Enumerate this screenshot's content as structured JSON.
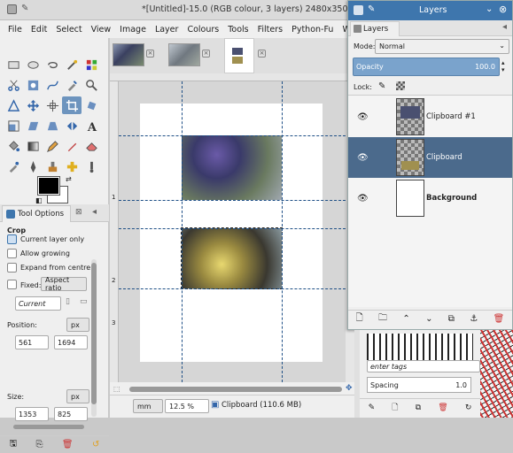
{
  "window": {
    "title": "*[Untitled]-15.0 (RGB colour, 3 layers) 2480x3508 – GIMP"
  },
  "menu": [
    "File",
    "Edit",
    "Select",
    "View",
    "Image",
    "Layer",
    "Colours",
    "Tools",
    "Filters",
    "Python-Fu",
    "Windows",
    "H"
  ],
  "tool_options": {
    "tab": "Tool Options",
    "section": "Crop",
    "current_layer_only": "Current layer only",
    "allow_growing": "Allow growing",
    "expand_from_centre": "Expand from centre",
    "fixed_label": "Fixed:",
    "fixed_value": "Aspect ratio",
    "current": "Current",
    "position_label": "Position:",
    "position_unit": "px",
    "pos_x": "561",
    "pos_y": "1694",
    "size_label": "Size:",
    "size_unit": "px",
    "size_w": "1353",
    "size_h": "825"
  },
  "statusbar": {
    "unit": "mm",
    "zoom": "12.5 %",
    "message": "Clipboard (110.6 MB)"
  },
  "ruler": {
    "v_labels": [
      "1",
      "2",
      "3"
    ],
    "h_labels": []
  },
  "layers": {
    "title": "Layers",
    "tab": "Layers",
    "mode_label": "Mode:",
    "mode_value": "Normal",
    "opacity_label": "Opacity",
    "opacity_value": "100.0",
    "lock_label": "Lock:",
    "items": [
      {
        "name": "Clipboard #1",
        "selected": false,
        "bold": false
      },
      {
        "name": "Clipboard",
        "selected": true,
        "bold": false
      },
      {
        "name": "Background",
        "selected": false,
        "bold": true
      }
    ]
  },
  "brushes": {
    "tags_placeholder": "enter tags",
    "spacing_label": "Spacing",
    "spacing_value": "1.0"
  },
  "colors": {
    "accent": "#3e76ad",
    "selected_row": "#4b6a8c",
    "guide": "#1e4f86"
  }
}
